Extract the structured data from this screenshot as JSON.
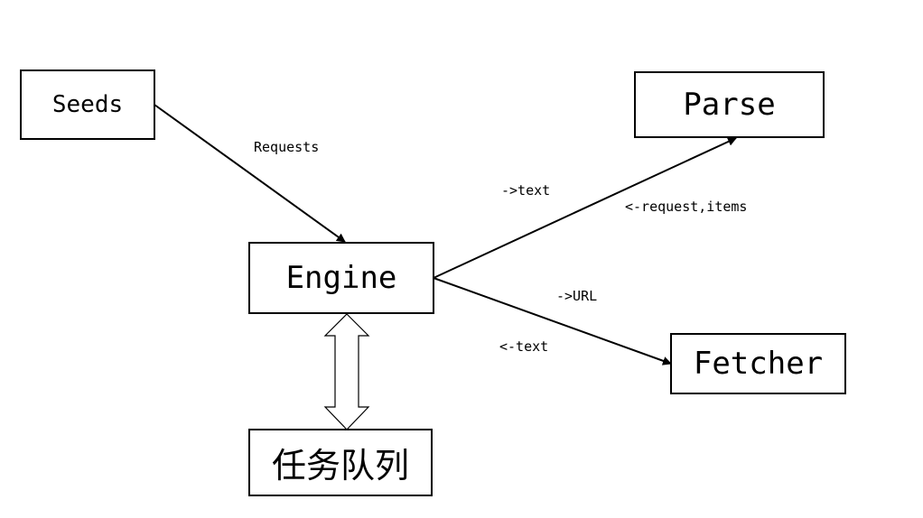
{
  "nodes": {
    "seeds": "Seeds",
    "engine": "Engine",
    "parse": "Parse",
    "fetcher": "Fetcher",
    "queue": "任务队列"
  },
  "edge_labels": {
    "seeds_to_engine": "Requests",
    "engine_to_parse": "->text",
    "parse_to_engine": "<-request,items",
    "engine_to_fetcher": "->URL",
    "fetcher_to_engine": "<-text"
  },
  "colors": {
    "stroke": "#000000",
    "background": "#ffffff"
  }
}
